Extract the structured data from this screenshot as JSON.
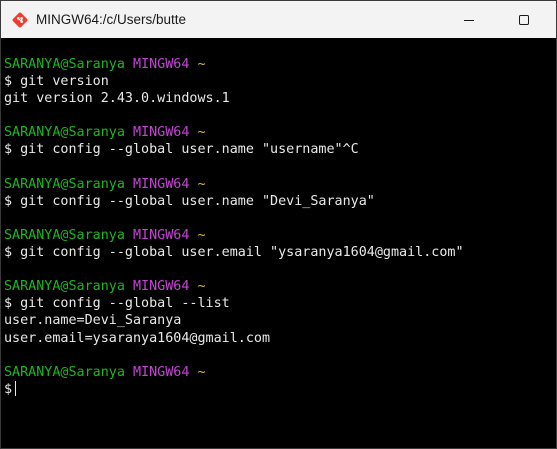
{
  "window": {
    "title": "MINGW64:/c/Users/butte"
  },
  "prompt": {
    "user_host": "SARANYA@Saranya",
    "env": "MINGW64",
    "dir": "~",
    "symbol": "$"
  },
  "blocks": [
    {
      "command": "git version",
      "output": [
        "git version 2.43.0.windows.1"
      ]
    },
    {
      "command": "git config --global user.name \"username\"^C",
      "output": []
    },
    {
      "command": "git config --global user.name \"Devi_Saranya\"",
      "output": []
    },
    {
      "command": "git config --global user.email \"ysaranya1604@gmail.com\"",
      "output": []
    },
    {
      "command": "git config --global --list",
      "output": [
        "user.name=Devi_Saranya",
        "user.email=ysaranya1604@gmail.com"
      ]
    }
  ],
  "current_input": "",
  "colors": {
    "user_host": "#1fb51f",
    "env": "#c344d4",
    "dir": "#d7ba3b",
    "text": "#e8e8e8",
    "background": "#000000",
    "titlebar": "#f3f3f3"
  },
  "icons": {
    "app": "git-bash-icon",
    "minimize": "minimize-icon",
    "maximize": "maximize-icon"
  }
}
